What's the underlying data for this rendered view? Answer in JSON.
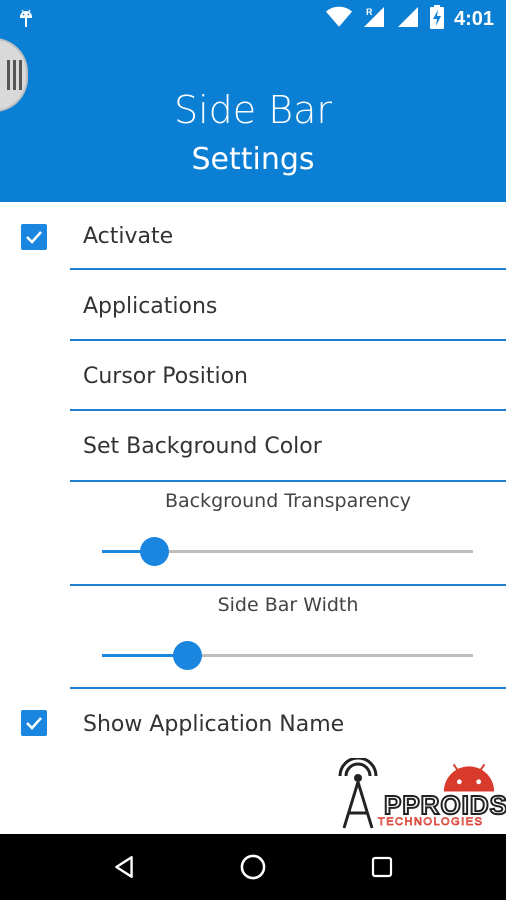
{
  "status_bar": {
    "time": "4:01",
    "left_icon": "android-debug-icon",
    "icons": [
      "wifi-icon",
      "signal-roaming-icon",
      "signal-icon",
      "battery-charging-icon"
    ]
  },
  "header": {
    "title": "Side Bar",
    "subtitle": "Settings",
    "handle_icon": "drag-handle-icon",
    "color": "#0a7fd4"
  },
  "settings": {
    "activate": {
      "label": "Activate",
      "checked": true
    },
    "applications": {
      "label": "Applications"
    },
    "cursor_position": {
      "label": "Cursor Position"
    },
    "background_color": {
      "label": "Set Background Color"
    },
    "transparency": {
      "label": "Background Transparency",
      "value_fraction": 0.14
    },
    "width": {
      "label": "Side Bar Width",
      "value_fraction": 0.23
    },
    "show_app_name": {
      "label": "Show Application Name",
      "checked": true
    }
  },
  "logo": {
    "text": "PPROIDS",
    "subtext": "TECHNOLOGIES",
    "prefix_letter": "A"
  },
  "nav_bar": {
    "icons": [
      "back-icon",
      "home-icon",
      "recents-icon"
    ]
  },
  "accent_color": "#1a86e0"
}
